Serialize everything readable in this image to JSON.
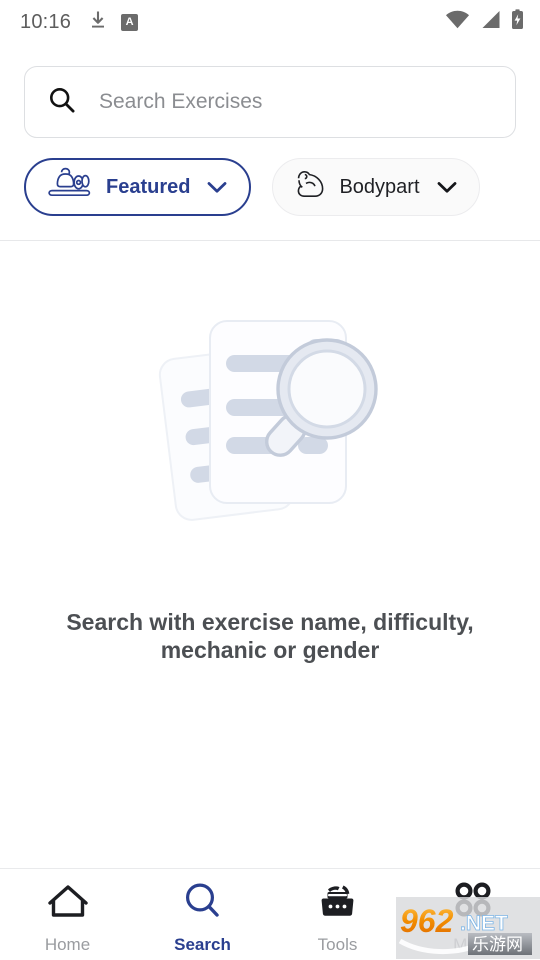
{
  "status_bar": {
    "time": "10:16",
    "left_icons": [
      "download-icon",
      "text-a-icon"
    ],
    "a_icon_letter": "A",
    "right_icons": [
      "wifi-icon",
      "cellular-signal-icon",
      "battery-charging-icon"
    ]
  },
  "search": {
    "placeholder": "Search Exercises",
    "value": "",
    "icon": "search-icon"
  },
  "filters": [
    {
      "label": "Featured",
      "icon": "kettlebell-weights-icon",
      "selected": true,
      "chevron": "chevron-down-icon"
    },
    {
      "label": "Bodypart",
      "icon": "flexed-bicep-icon",
      "selected": false,
      "chevron": "chevron-down-icon"
    }
  ],
  "empty_state": {
    "illustration": "documents-with-magnifier-icon",
    "message": "Search with exercise name, difficulty, mechanic or gender"
  },
  "bottom_nav": {
    "items": [
      {
        "label": "Home",
        "icon": "home-icon",
        "active": false
      },
      {
        "label": "Search",
        "icon": "search-icon",
        "active": true
      },
      {
        "label": "Tools",
        "icon": "toolbox-icon",
        "active": false
      },
      {
        "label": "More",
        "icon": "four-circles-grid-icon",
        "active": false
      }
    ]
  },
  "watermark": {
    "number": "962",
    "tld": ".NET",
    "chinese": "乐游网"
  },
  "colors": {
    "accent": "#2a3f8f",
    "placeholder": "#8b8d91",
    "muted": "#9a9ca0",
    "text": "#4c4f53",
    "illustration_light": "#f4f6fa",
    "illustration_bar": "#d2d9e6",
    "watermark_orange": "#f08000",
    "watermark_blue": "#5aa7e0"
  }
}
